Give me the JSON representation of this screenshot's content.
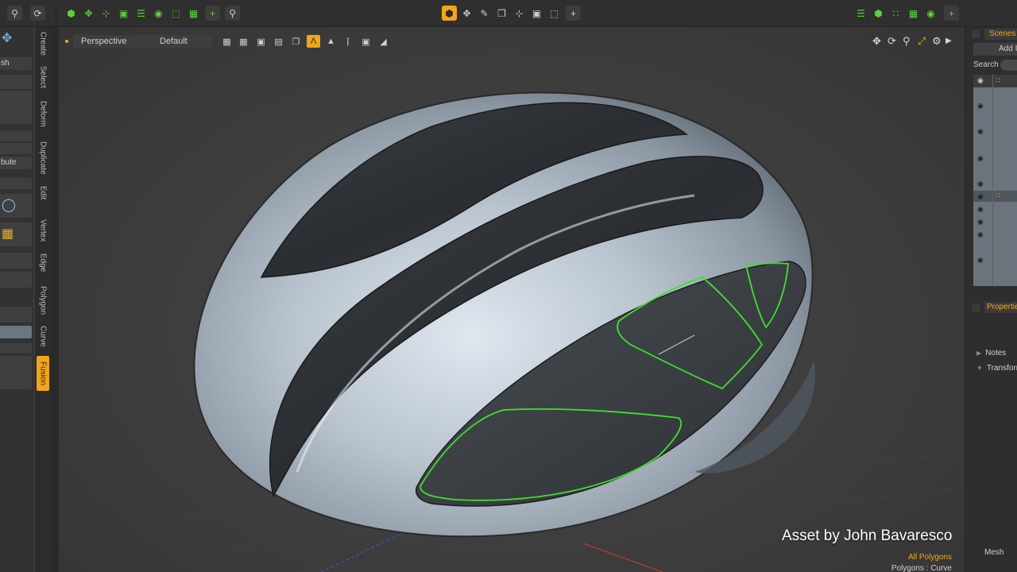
{
  "toolbar": {
    "left_icons": [
      "cube-icon",
      "move-icon",
      "vertex-tool-icon",
      "box-select-icon",
      "layers-icon",
      "center-icon",
      "bounds-icon",
      "frame-icon",
      "add-icon",
      "zoom-icon"
    ],
    "center_icons": [
      "wireframe-cube-icon",
      "grid-icon",
      "pen-icon",
      "copy-icon",
      "curve-icon",
      "camera-icon",
      "fit-icon",
      "add-icon"
    ],
    "right_icons": [
      "list-icon",
      "layers-icon",
      "scatter-icon",
      "image-icon",
      "camera-icon",
      "add-icon"
    ]
  },
  "left_panel": {
    "items": [
      {
        "label": "sh"
      },
      {
        "label": "bute"
      }
    ],
    "vertical_tabs": [
      "Create",
      "Select",
      "Deform",
      "Duplicate",
      "Edit",
      "Vertex",
      "Edge",
      "Polygon",
      "Curve",
      "Fusion"
    ],
    "active_tab": "Fusion"
  },
  "viewport": {
    "view_name": "Perspective",
    "style_name": "Default",
    "asset_credit": "Asset by John Bavaresco",
    "selection_mode": "All Polygons",
    "component_mode": "Polygons : Curve"
  },
  "right_panel": {
    "scenes_tab": "Scenes",
    "add_button": "Add I",
    "search_label": "Search",
    "properties_tab": "Propertie",
    "sections": [
      "Notes",
      "Transform"
    ],
    "bottom_label": "Mesh"
  },
  "colors": {
    "accent": "#f2a51a",
    "selection_outline": "#3fe02a",
    "green_icon": "#5fcf3a"
  }
}
